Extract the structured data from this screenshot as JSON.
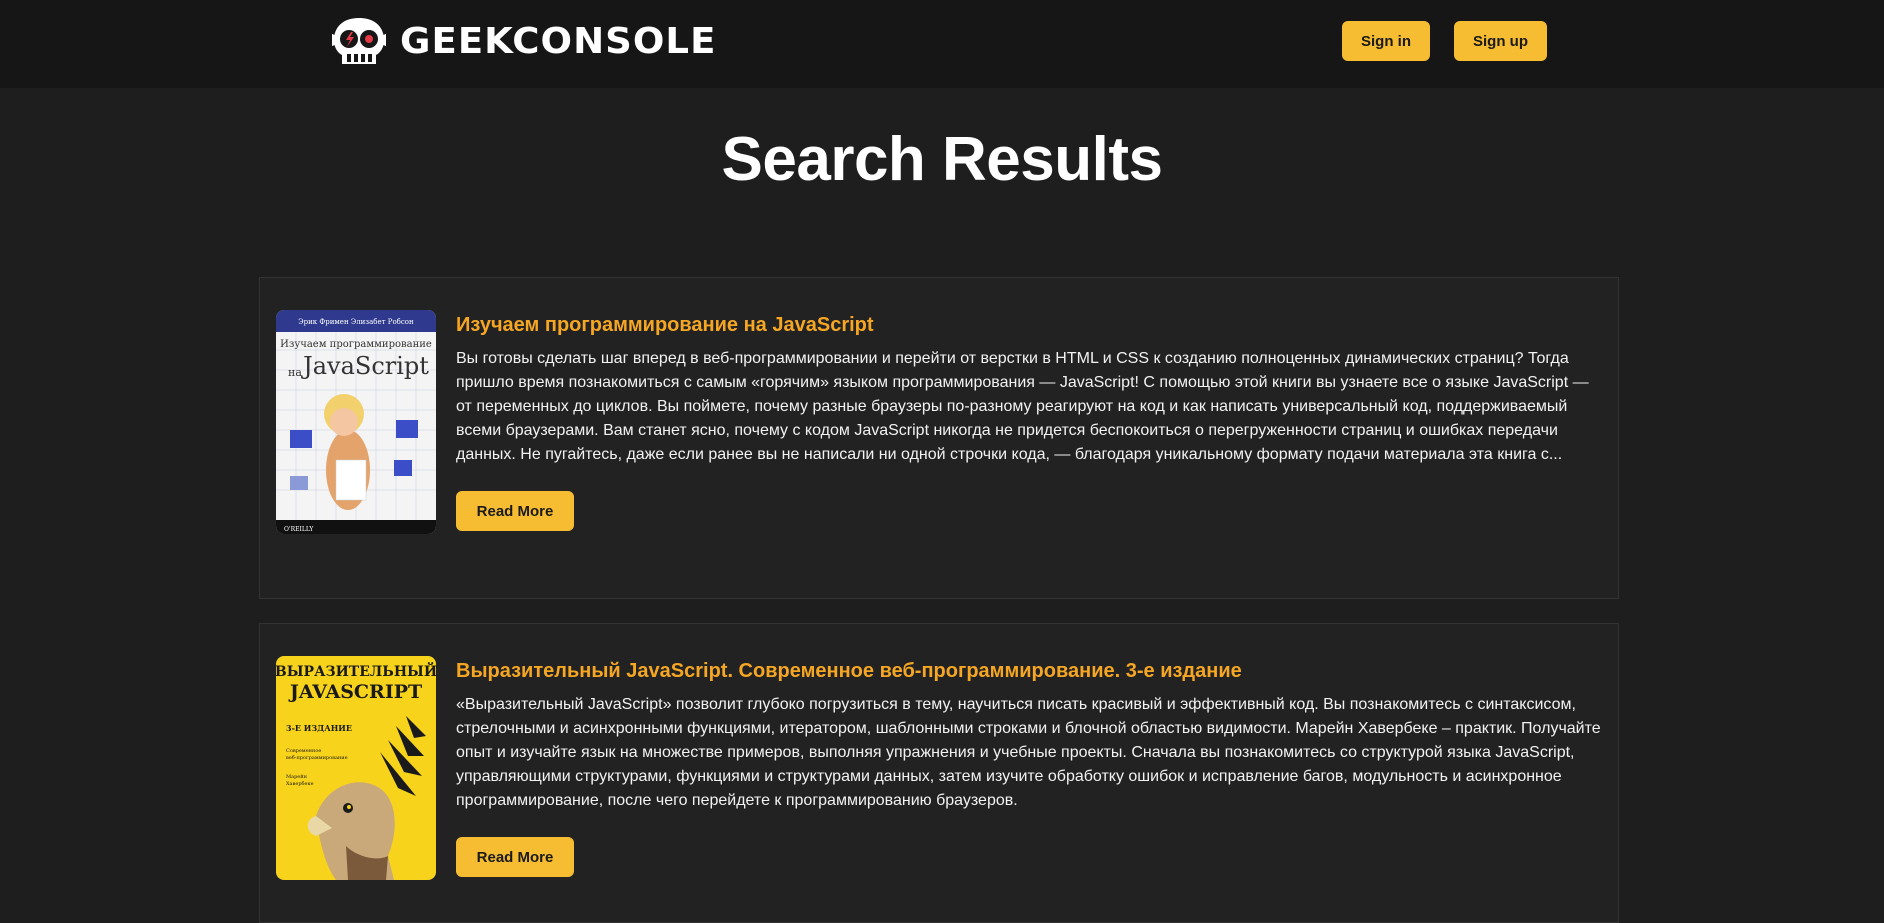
{
  "header": {
    "logo_text": "GEEKCONSOLE",
    "sign_in_label": "Sign in",
    "sign_up_label": "Sign up"
  },
  "main": {
    "title": "Search Results"
  },
  "results": [
    {
      "title": "Изучаем программирование на JavaScript",
      "description": "Вы готовы сделать шаг вперед в веб-программировании и перейти от верстки в HTML и CSS к созданию полноценных динамических страниц? Тогда пришло время познакомиться с самым «горячим» языком программирования — JavaScript! С помощью этой книги вы узнаете все о языке JavaScript — от переменных до циклов. Вы поймете, почему разные браузеры по-разному реагируют на код и как написать универсальный код, поддерживаемый всеми браузерами. Вам станет ясно, почему с кодом JavaScript никогда не придется беспокоиться о перегруженности страниц и ошибках передачи данных. Не пугайтесь, даже если ранее вы не написали ни одной строчки кода, — благодаря уникальному формату подачи материала эта книга с...",
      "read_more_label": "Read More",
      "cover": {
        "authors": "Эрик Фримен   Элизабет Робсон",
        "line1": "Изучаем программирование",
        "line2": "на",
        "line3": "JavaScript",
        "publisher": "O'REILLY"
      }
    },
    {
      "title": "Выразительный JavaScript. Современное веб-программирование. 3-е издание",
      "description": "«Выразительный JavaScript» позволит глубоко погрузиться в тему, научиться писать красивый и эффективный код. Вы познакомитесь с синтаксисом, стрелочными и асинхронными функциями, итератором, шаблонными строками и блочной областью видимости. Марейн Хавербеке – практик. Получайте опыт и изучайте язык на множестве примеров, выполняя упражнения и учебные проекты. Сначала вы познакомитесь со структурой языка JavaScript, управляющими структурами, функциями и структурами данных, затем изучите обработку ошибок и исправление багов, модульность и асинхронное программирование, после чего перейдете к программированию браузеров.",
      "read_more_label": "Read More",
      "cover": {
        "line1": "ВЫРАЗИТЕЛЬНЫЙ",
        "line2": "JAVASCRIPT",
        "edition": "3-Е ИЗДАНИЕ",
        "sub1": "Современное",
        "sub2": "веб-программирование",
        "author1": "Марейн",
        "author2": "Хавербеке"
      }
    }
  ],
  "colors": {
    "accent": "#f7bd32",
    "title_orange": "#f5a623",
    "background": "#1e1e1e",
    "header_bg": "#161616"
  }
}
